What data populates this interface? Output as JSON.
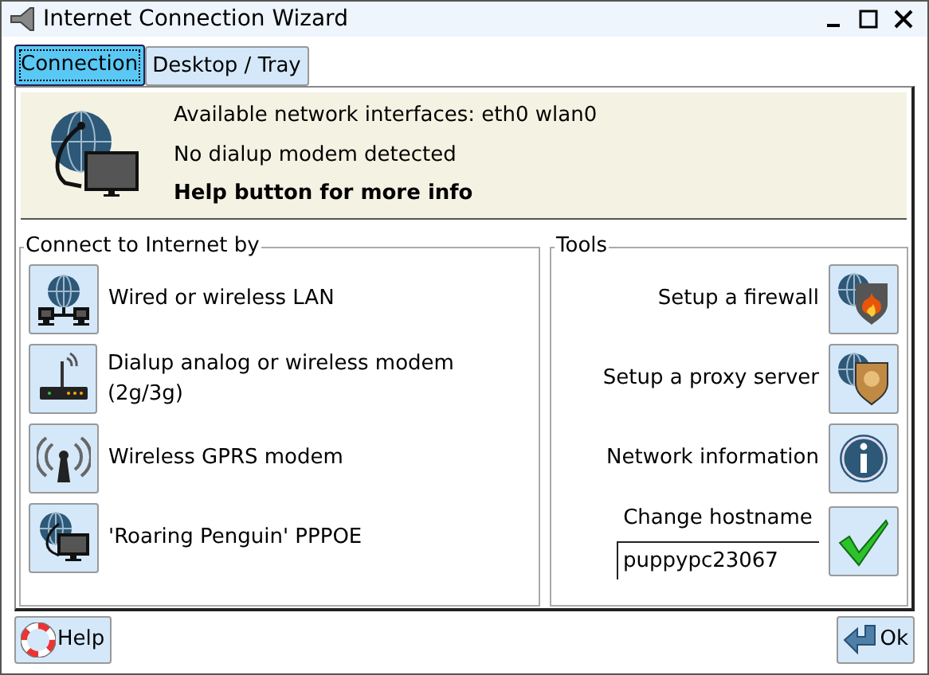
{
  "window": {
    "title": "Internet Connection Wizard"
  },
  "tabs": [
    {
      "label": "Connection",
      "selected": true
    },
    {
      "label": "Desktop / Tray",
      "selected": false
    }
  ],
  "info": {
    "lines": [
      "Available network interfaces: eth0 wlan0",
      "No dialup modem detected"
    ],
    "hint": "Help button for more info"
  },
  "connect": {
    "title": "Connect to Internet by",
    "items": [
      {
        "kind": "lan",
        "label": "Wired or wireless LAN"
      },
      {
        "kind": "modem",
        "label": "Dialup analog or wireless modem (2g/3g)"
      },
      {
        "kind": "gprs",
        "label": "Wireless GPRS modem"
      },
      {
        "kind": "pppoe",
        "label": "'Roaring Penguin' PPPOE"
      }
    ]
  },
  "tools": {
    "title": "Tools",
    "items": [
      {
        "kind": "firewall",
        "label": "Setup a firewall"
      },
      {
        "kind": "proxy",
        "label": "Setup a proxy server"
      },
      {
        "kind": "info",
        "label": "Network information"
      }
    ],
    "hostname": {
      "label": "Change hostname",
      "value": "puppypc23067"
    }
  },
  "buttons": {
    "help": "Help",
    "ok": "Ok"
  }
}
